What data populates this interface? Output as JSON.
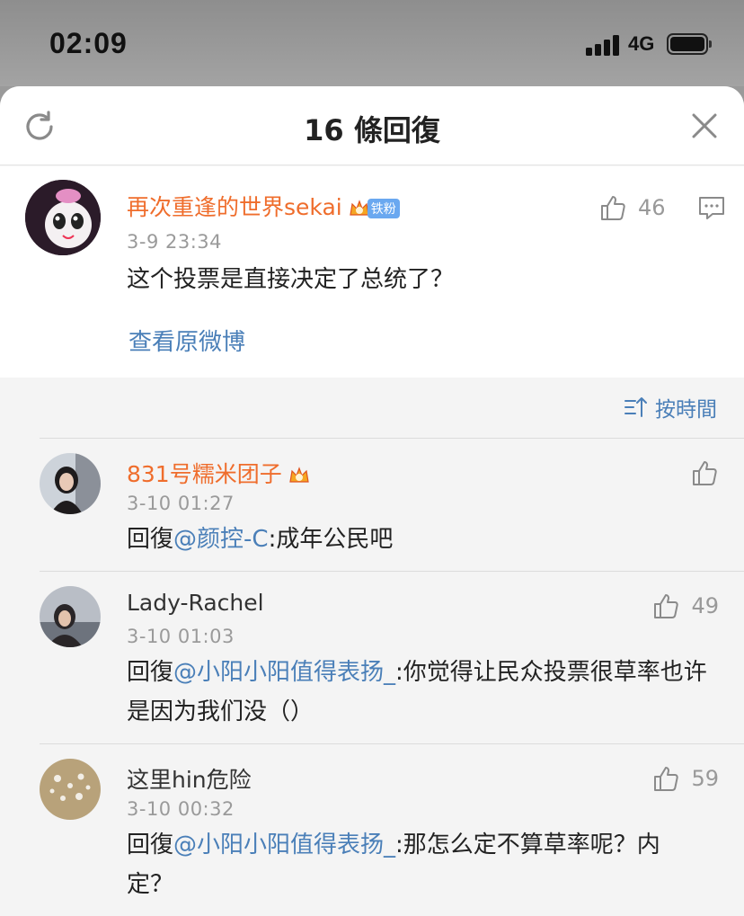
{
  "status_bar": {
    "time": "02:09",
    "network": "4G"
  },
  "sheet": {
    "title": "16 條回復"
  },
  "main_post": {
    "username": "再次重逢的世界sekai",
    "fan_badge": "铁粉",
    "time": "3-9 23:34",
    "text": "这个投票是直接决定了总统了？",
    "likes": "46",
    "view_original": "查看原微博"
  },
  "sort": {
    "label": "按時間"
  },
  "comments": [
    {
      "username": "831号糯米团子",
      "time": "3-10 01:27",
      "reply_prefix": "回復",
      "mention": "@颜控-C",
      "text": ":成年公民吧",
      "likes": ""
    },
    {
      "username": "Lady-Rachel",
      "time": "3-10 01:03",
      "reply_prefix": "回復",
      "mention": "@小阳小阳值得表扬_",
      "text": ":你觉得让民众投票很草率也许是因为我们没（）",
      "likes": "49"
    },
    {
      "username": "这里hin危险",
      "time": "3-10 00:32",
      "reply_prefix": "回復",
      "mention": "@小阳小阳值得表扬_",
      "text": ":那怎么定不算草率呢？内定？",
      "likes": "59"
    }
  ],
  "colors": {
    "username": "#ef6d2c",
    "link": "#4a7fb8",
    "meta": "#9a9a9a"
  }
}
